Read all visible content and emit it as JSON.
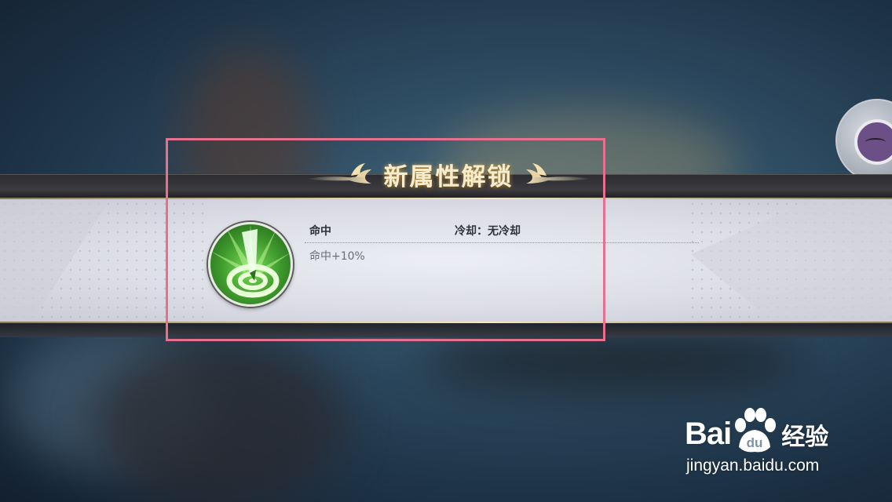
{
  "banner": {
    "title": "新属性解锁"
  },
  "attribute": {
    "name": "命中",
    "cooldown": "冷却：无冷却",
    "description": "命中+10%",
    "icon": "target-arrow-icon"
  },
  "watermark": {
    "logo_text_left": "Bai",
    "logo_text_paw": "du",
    "logo_text_right": "经验",
    "url": "jingyan.baidu.com"
  },
  "colors": {
    "highlight_frame": "#e8708f",
    "title_gold": "#f6ecd0",
    "icon_green": "#3f9a2c"
  }
}
